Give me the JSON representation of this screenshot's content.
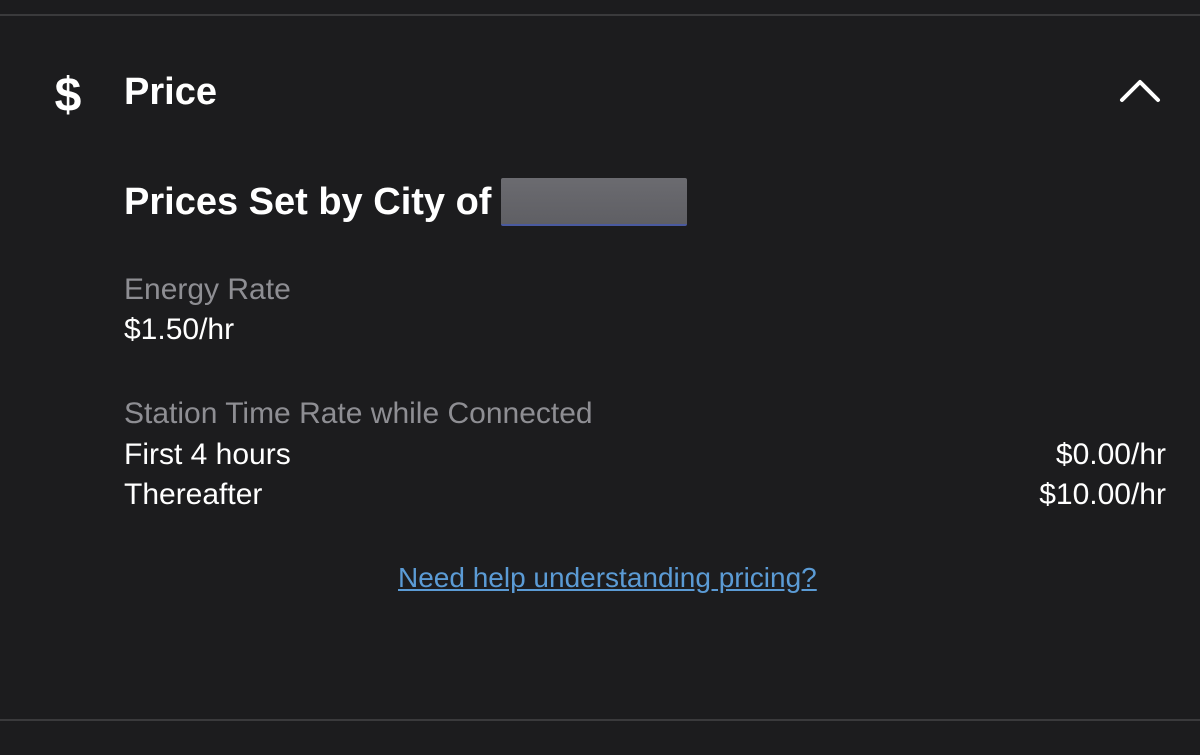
{
  "section": {
    "icon": "dollar-sign-icon",
    "icon_glyph": "$",
    "title": "Price",
    "collapse_icon": "chevron-up-icon"
  },
  "pricing": {
    "subtitle": "Prices Set by City of",
    "energy": {
      "label": "Energy Rate",
      "value": "$1.50/hr"
    },
    "station_time": {
      "label": "Station Time Rate while Connected",
      "tiers": [
        {
          "label": "First 4 hours",
          "value": "$0.00/hr"
        },
        {
          "label": "Thereafter",
          "value": "$10.00/hr"
        }
      ]
    },
    "help_link": "Need help understanding pricing?"
  },
  "colors": {
    "background": "#1c1c1e",
    "divider": "#3a3a3c",
    "secondary_text": "#8e8e93",
    "link": "#5b9bd5"
  }
}
